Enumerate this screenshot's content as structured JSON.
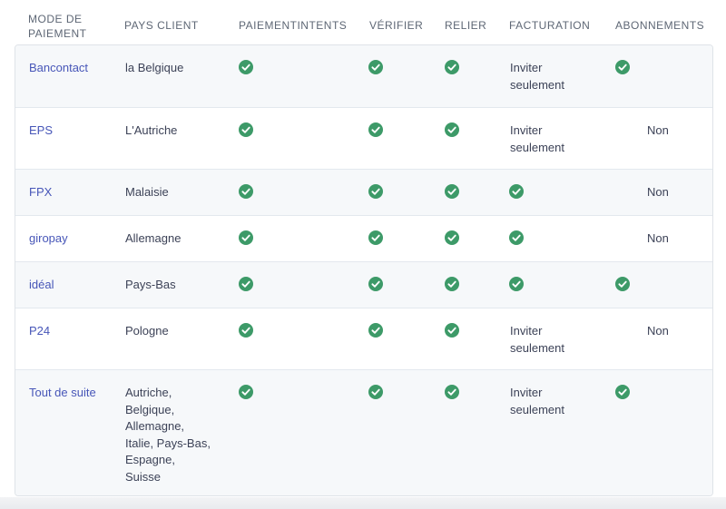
{
  "columns": [
    "MODE DE PAIEMENT",
    "PAYS CLIENT",
    "PAIEMENTINTENTS",
    "VÉRIFIER",
    "RELIER",
    "FACTURATION",
    "ABONNEMENTS"
  ],
  "check_icon_color": "#3d9a68",
  "rows": [
    {
      "method": "Bancontact",
      "country": "la Belgique",
      "paymentintents": true,
      "verify": true,
      "link": true,
      "billing": "Inviter seulement",
      "billing_check": false,
      "subs_check": true,
      "subs_text": ""
    },
    {
      "method": "EPS",
      "country": "L'Autriche",
      "paymentintents": true,
      "verify": true,
      "link": true,
      "billing": "Inviter seulement",
      "billing_check": false,
      "subs_check": false,
      "subs_text": "Non"
    },
    {
      "method": "FPX",
      "country": "Malaisie",
      "paymentintents": true,
      "verify": true,
      "link": true,
      "billing": "",
      "billing_check": true,
      "subs_check": false,
      "subs_text": "Non"
    },
    {
      "method": "giropay",
      "country": "Allemagne",
      "paymentintents": true,
      "verify": true,
      "link": true,
      "billing": "",
      "billing_check": true,
      "subs_check": false,
      "subs_text": "Non"
    },
    {
      "method": "idéal",
      "country": "Pays-Bas",
      "paymentintents": true,
      "verify": true,
      "link": true,
      "billing": "",
      "billing_check": true,
      "subs_check": true,
      "subs_text": ""
    },
    {
      "method": "P24",
      "country": "Pologne",
      "paymentintents": true,
      "verify": true,
      "link": true,
      "billing": "Inviter seulement",
      "billing_check": false,
      "subs_check": false,
      "subs_text": "Non"
    },
    {
      "method": "Tout de suite",
      "country": "Autriche, Belgique, Allemagne, Italie, Pays-Bas, Espagne, Suisse",
      "paymentintents": true,
      "verify": true,
      "link": true,
      "billing": "Inviter seulement",
      "billing_check": false,
      "subs_check": true,
      "subs_text": ""
    }
  ]
}
